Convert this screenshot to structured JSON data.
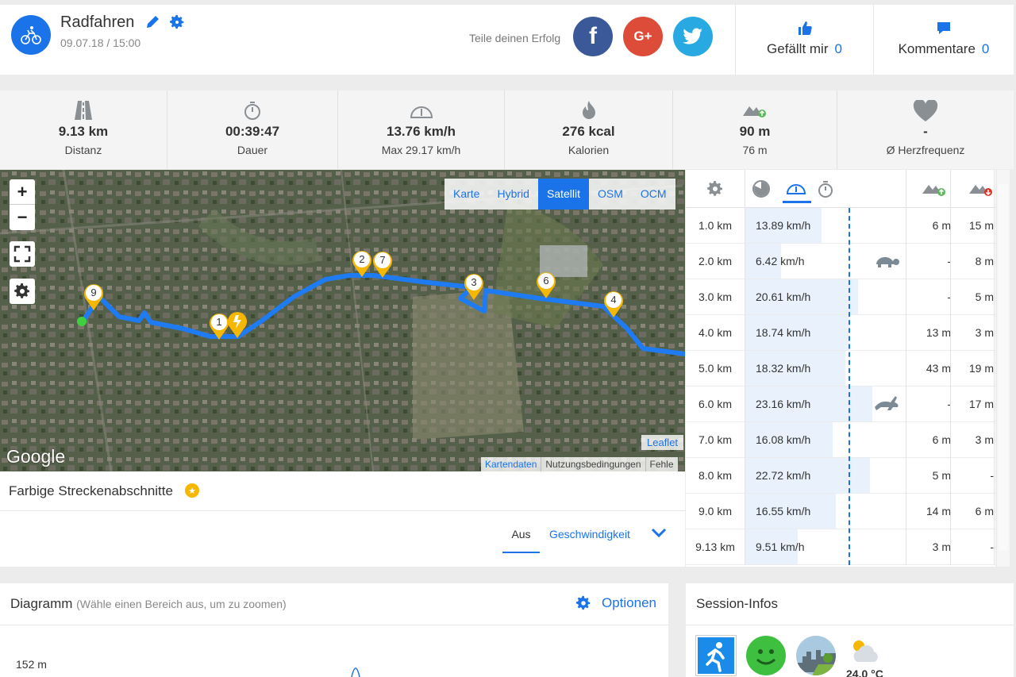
{
  "header": {
    "title": "Radfahren",
    "date": "09.07.18 / 15:00",
    "share_label": "Teile deinen Erfolg",
    "social": {
      "facebook": "f",
      "googleplus": "G+",
      "twitter": "twitter-bird-icon"
    },
    "likes": {
      "label": "Gefällt mir",
      "count": "0"
    },
    "comments": {
      "label": "Kommentare",
      "count": "0"
    }
  },
  "stats": [
    {
      "icon": "road-icon",
      "value": "9.13 km",
      "label": "Distanz"
    },
    {
      "icon": "stopwatch-icon",
      "value": "00:39:47",
      "label": "Dauer"
    },
    {
      "icon": "speedometer-icon",
      "value": "13.76 km/h",
      "label": "Max 29.17 km/h"
    },
    {
      "icon": "flame-icon",
      "value": "276 kcal",
      "label": "Kalorien"
    },
    {
      "icon": "elevation-up-icon",
      "value": "90 m",
      "label": "76 m"
    },
    {
      "icon": "heart-icon",
      "value": "-",
      "label": "Ø Herzfrequenz"
    }
  ],
  "map": {
    "layers": [
      "Karte",
      "Hybrid",
      "Satellit",
      "OSM",
      "OCM"
    ],
    "active_layer": "Satellit",
    "zoom_in": "+",
    "zoom_out": "−",
    "google": "Google",
    "leaflet": "Leaflet",
    "attribution": [
      "Kartendaten",
      "Nutzungsbedingungen",
      "Fehle"
    ],
    "markers": [
      "1",
      "2",
      "3",
      "4",
      "6",
      "7",
      "9"
    ]
  },
  "sections": {
    "title": "Farbige Streckenabschnitte",
    "option_off": "Aus",
    "option_speed": "Geschwindigkeit"
  },
  "splits": {
    "rows": [
      {
        "km": "1.0 km",
        "speed": "13.89 km/h",
        "fraction": 0.6,
        "up": "6 m",
        "down": "15 m",
        "badge": ""
      },
      {
        "km": "2.0 km",
        "speed": "6.42 km/h",
        "fraction": 0.28,
        "up": "-",
        "down": "8 m",
        "badge": "turtle-icon"
      },
      {
        "km": "3.0 km",
        "speed": "20.61 km/h",
        "fraction": 0.89,
        "up": "-",
        "down": "5 m",
        "badge": ""
      },
      {
        "km": "4.0 km",
        "speed": "18.74 km/h",
        "fraction": 0.81,
        "up": "13 m",
        "down": "3 m",
        "badge": ""
      },
      {
        "km": "5.0 km",
        "speed": "18.32 km/h",
        "fraction": 0.79,
        "up": "43 m",
        "down": "19 m",
        "badge": ""
      },
      {
        "km": "6.0 km",
        "speed": "23.16 km/h",
        "fraction": 1.0,
        "up": "-",
        "down": "17 m",
        "badge": "rabbit-icon"
      },
      {
        "km": "7.0 km",
        "speed": "16.08 km/h",
        "fraction": 0.69,
        "up": "6 m",
        "down": "3 m",
        "badge": ""
      },
      {
        "km": "8.0 km",
        "speed": "22.72 km/h",
        "fraction": 0.98,
        "up": "5 m",
        "down": "-",
        "badge": ""
      },
      {
        "km": "9.0 km",
        "speed": "16.55 km/h",
        "fraction": 0.71,
        "up": "14 m",
        "down": "6 m",
        "badge": ""
      },
      {
        "km": "9.13 km",
        "speed": "9.51 km/h",
        "fraction": 0.41,
        "up": "3 m",
        "down": "-",
        "badge": ""
      }
    ]
  },
  "diagram": {
    "title": "Diagramm",
    "hint": "(Wähle einen Bereich aus, um zu zoomen)",
    "options": "Optionen",
    "y_label": "152 m"
  },
  "session": {
    "title": "Session-Infos",
    "temperature": "24.0 °C"
  },
  "colors": {
    "accent": "#1a73e8",
    "marker": "#f5b700",
    "turtle": "#7b8a95"
  }
}
